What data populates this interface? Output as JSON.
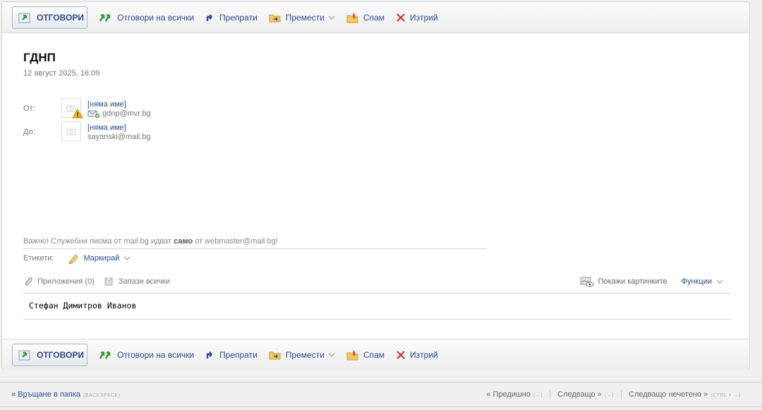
{
  "toolbar": {
    "reply": "ОТГОВОРИ",
    "reply_all": "Отговори на всички",
    "forward": "Препрати",
    "move": "Премести",
    "spam": "Спам",
    "delete": "Изтрий"
  },
  "message": {
    "subject": "ГДНП",
    "date": "12 август 2025, 16:09",
    "from_label": "От:",
    "from_name": "[няма име]",
    "from_email": "gdnp@mvr.bg",
    "to_label": "До:",
    "to_name": "[няма име]",
    "to_email": "sayanski@mail.bg",
    "notice_prefix": "Важно! Служебни писма от mail.bg идват ",
    "notice_bold": "само",
    "notice_suffix": " от webmaster@mail.bg!",
    "labels_label": "Етикети:",
    "labels_action": "Маркирай",
    "attachments": "Приложения (0)",
    "save_all": "Запази всички",
    "show_images": "Покажи картинките",
    "functions": "Функции",
    "body": "Стефан Димитров Иванов"
  },
  "footer": {
    "back": "« Връщане в папка",
    "back_hint": "(BACKSPACE)",
    "prev": "« Предишно",
    "prev_hint": "(←)",
    "next": "Следващо »",
    "next_hint": "(→)",
    "next_unread": "Следващо нечетено »",
    "next_unread_hint": "(CTRL + →)"
  },
  "colors": {
    "link": "#2a4d8f",
    "reply_icon": "#3a9b3a",
    "delete_icon": "#d2352b",
    "warning": "#f2b705"
  }
}
